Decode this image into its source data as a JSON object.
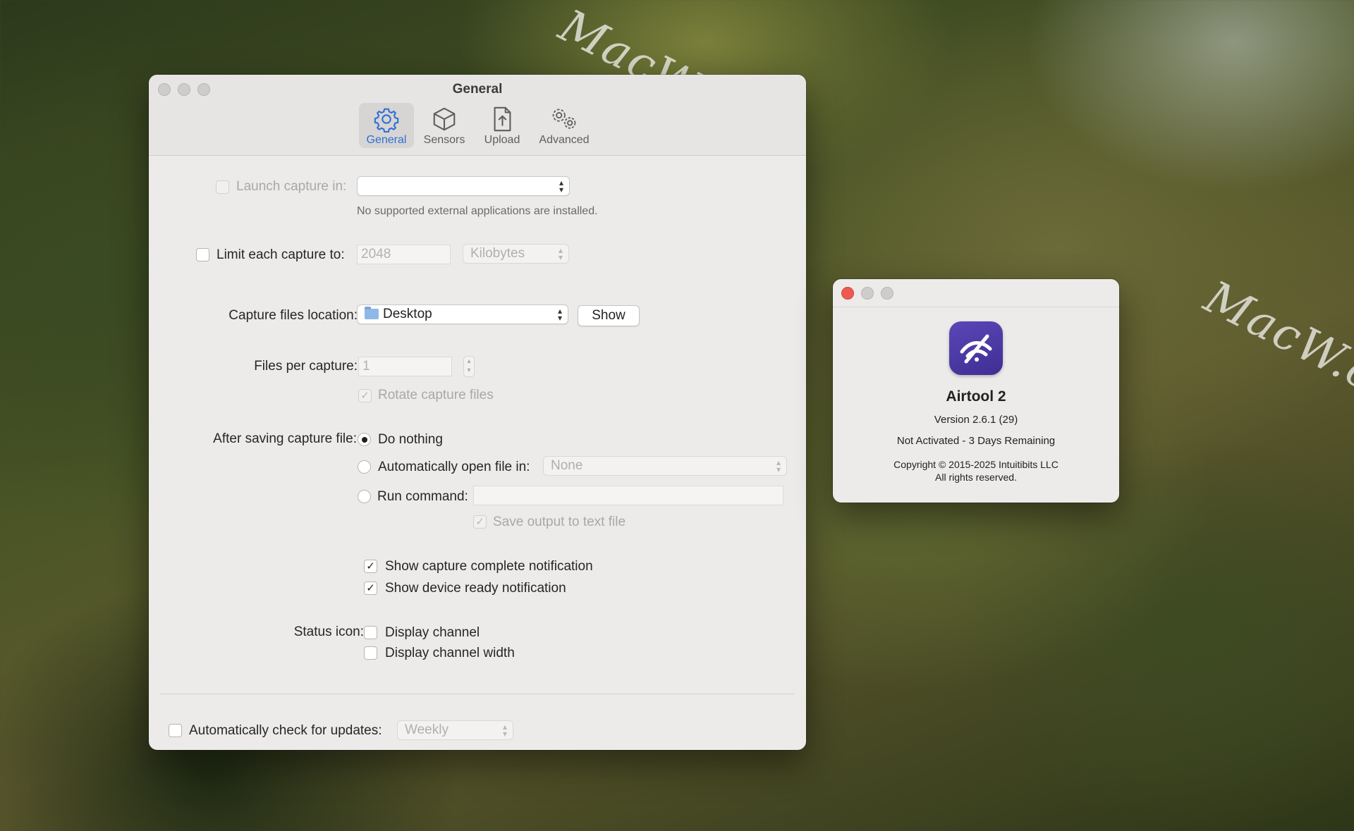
{
  "watermark": "MacW.com",
  "prefs": {
    "title": "General",
    "tabs": [
      {
        "label": "General",
        "icon": "gear-icon",
        "active": true
      },
      {
        "label": "Sensors",
        "icon": "cube-icon",
        "active": false
      },
      {
        "label": "Upload",
        "icon": "upload-doc-icon",
        "active": false
      },
      {
        "label": "Advanced",
        "icon": "gears-icon",
        "active": false
      }
    ],
    "launch_capture": {
      "label": "Launch capture in:",
      "value": "",
      "note": "No supported external applications are installed."
    },
    "limit_capture": {
      "label": "Limit each capture to:",
      "value": "2048",
      "unit": "Kilobytes"
    },
    "capture_location": {
      "label": "Capture files location:",
      "value": "Desktop",
      "button": "Show"
    },
    "files_per_capture": {
      "label": "Files per capture:",
      "value": "1",
      "rotate_label": "Rotate capture files"
    },
    "after_saving": {
      "label": "After saving capture file:",
      "options": [
        "Do nothing",
        "Automatically open file in:",
        "Run command:"
      ],
      "open_in_value": "None",
      "save_output_label": "Save output to text file"
    },
    "notifications": [
      "Show capture complete notification",
      "Show device ready notification"
    ],
    "status_icon": {
      "label": "Status icon:",
      "options": [
        "Display channel",
        "Display channel width"
      ]
    },
    "updates": {
      "label": "Automatically check for updates:",
      "value": "Weekly"
    }
  },
  "about": {
    "app_name": "Airtool 2",
    "version": "Version 2.6.1 (29)",
    "activation": "Not Activated - 3 Days Remaining",
    "copyright": "Copyright © 2015-2025 Intuitibits LLC",
    "rights": "All rights reserved.",
    "accent": "#4a37a6"
  },
  "colors": {
    "accent": "#2f6fd6",
    "close_button": "#ee5a52"
  }
}
